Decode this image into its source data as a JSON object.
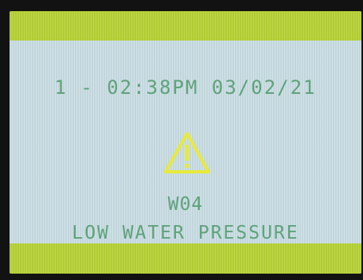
{
  "display": {
    "datetime": "1 - 02:38PM 03/02/21",
    "warning_code": "W04",
    "warning_message": "LOW WATER PRESSURE",
    "icon": "warning-triangle-icon"
  },
  "colors": {
    "accent_bar": "#b7d336",
    "screen_background": "#c9dde3",
    "text": "#5fa27a",
    "warning_icon": "#e7ea3a"
  }
}
